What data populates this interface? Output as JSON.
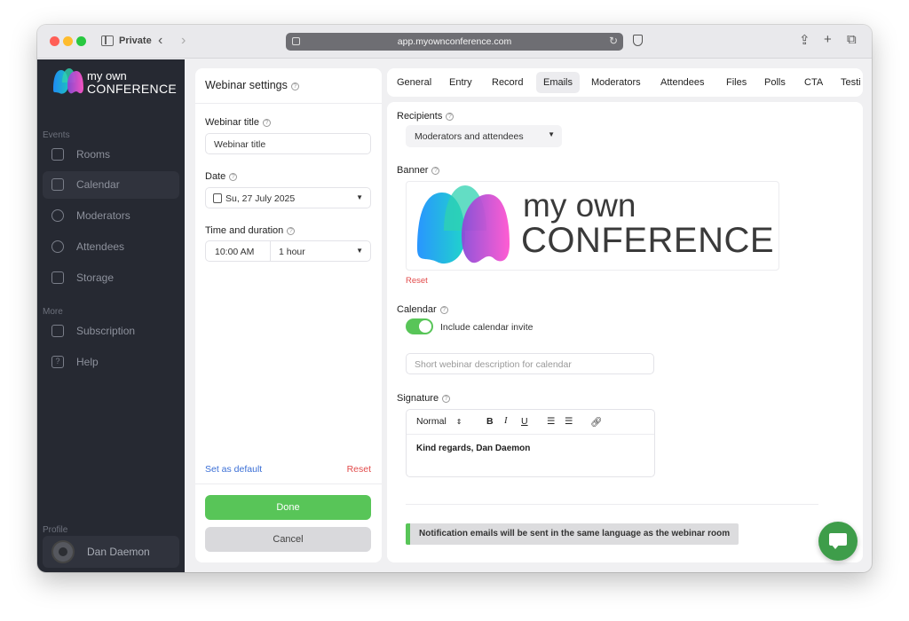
{
  "browser": {
    "private_label": "Private",
    "url": "app.myownconference.com"
  },
  "sidebar": {
    "logo_line1": "my own",
    "logo_line2": "CONFERENCE",
    "events_label": "Events",
    "more_label": "More",
    "profile_label": "Profile",
    "items": [
      {
        "label": "Rooms"
      },
      {
        "label": "Calendar"
      },
      {
        "label": "Moderators"
      },
      {
        "label": "Attendees"
      },
      {
        "label": "Storage"
      },
      {
        "label": "Subscription"
      },
      {
        "label": "Help"
      }
    ],
    "profile_name": "Dan Daemon"
  },
  "settings": {
    "title": "Webinar settings",
    "webinar_title_label": "Webinar title",
    "webinar_title_value": "Webinar title",
    "date_label": "Date",
    "date_value": "Su, 27 July 2025",
    "time_label": "Time and duration",
    "time_value": "10:00 AM",
    "duration_value": "1 hour",
    "set_default": "Set as default",
    "reset": "Reset",
    "done": "Done",
    "cancel": "Cancel"
  },
  "tabs": [
    {
      "label": "General"
    },
    {
      "label": "Entry"
    },
    {
      "label": "Record"
    },
    {
      "label": "Emails"
    },
    {
      "label": "Moderators"
    },
    {
      "label": "Attendees"
    },
    {
      "label": "Files"
    },
    {
      "label": "Polls"
    },
    {
      "label": "CTA"
    },
    {
      "label": "Testi"
    }
  ],
  "active_tab": "Emails",
  "emails": {
    "recipients_label": "Recipients",
    "recipients_value": "Moderators and attendees",
    "banner_label": "Banner",
    "banner_line1": "my own",
    "banner_line2": "CONFERENCE",
    "banner_reset": "Reset",
    "calendar_label": "Calendar",
    "include_calendar": "Include calendar invite",
    "include_calendar_on": true,
    "calendar_desc_placeholder": "Short webinar description for calendar",
    "signature_label": "Signature",
    "editor_format": "Normal",
    "signature_text": "Kind regards, Dan Daemon",
    "notice": "Notification emails will be sent in the same language as the webinar room"
  },
  "colors": {
    "accent_green": "#58c558",
    "link_blue": "#3b6fd6",
    "danger_red": "#e24b4b",
    "sidebar_bg": "#262932"
  }
}
